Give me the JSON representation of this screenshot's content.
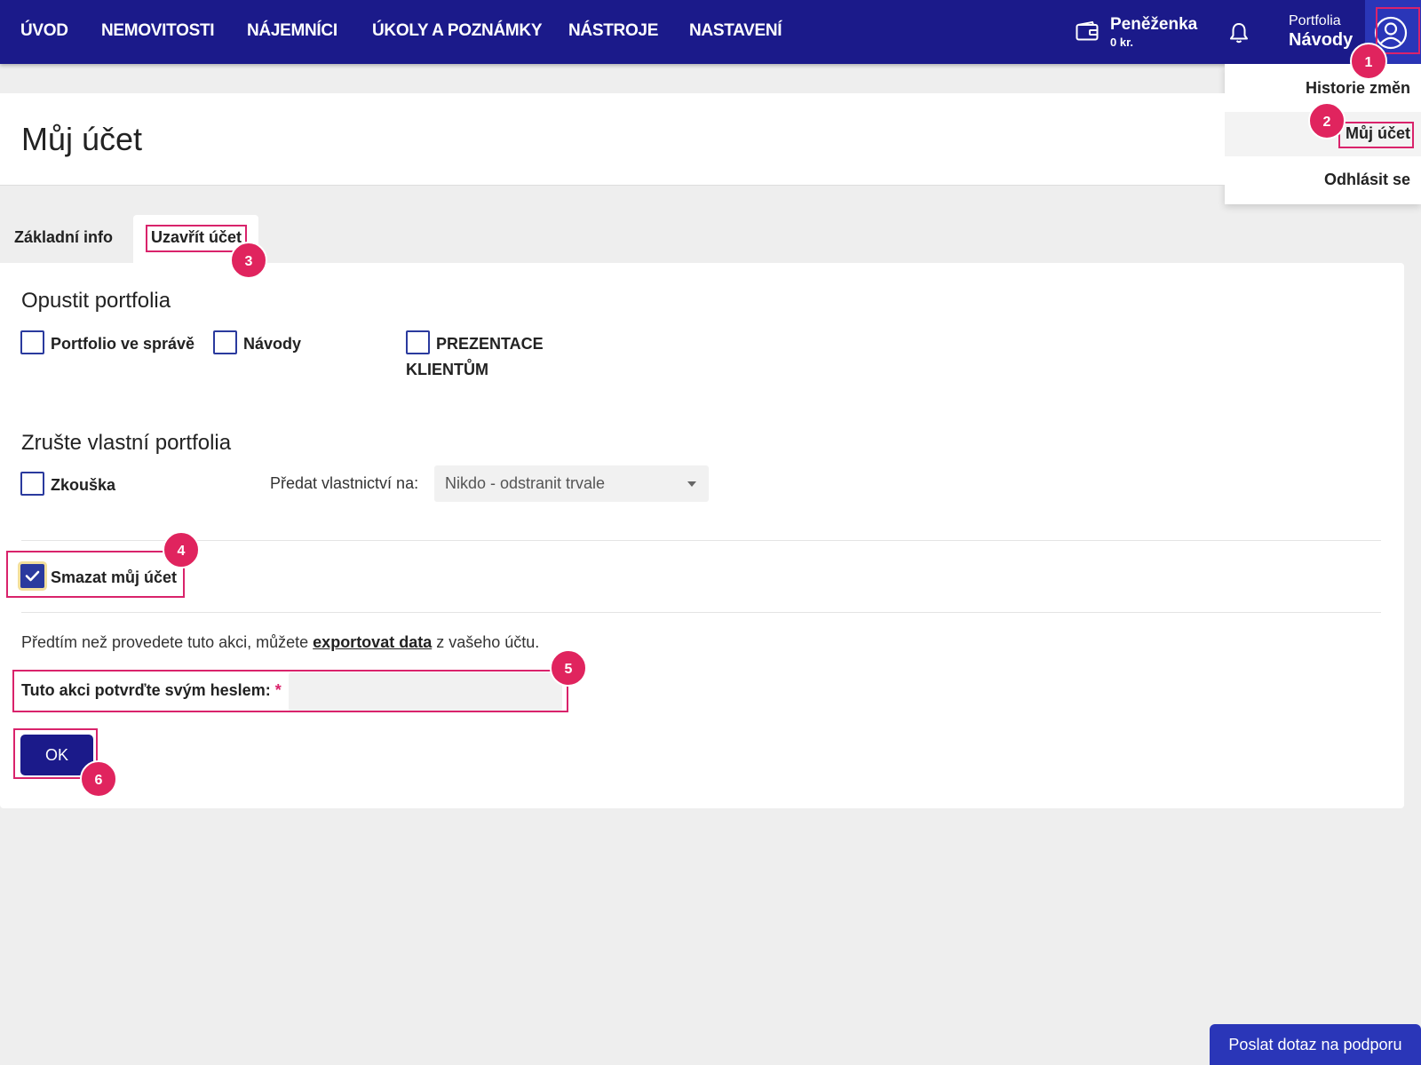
{
  "topnav": {
    "items": [
      "ÚVOD",
      "NEMOVITOSTI",
      "NÁJEMNÍCI",
      "ÚKOLY A POZNÁMKY",
      "NÁSTROJE",
      "NASTAVENÍ"
    ],
    "wallet": {
      "label": "Peněženka",
      "amount": "0 kr."
    },
    "portfolio": {
      "label": "Portfolia",
      "name": "Návody"
    }
  },
  "user_menu": {
    "items": [
      "Historie změn",
      "Můj účet",
      "Odhlásit se"
    ]
  },
  "page": {
    "title": "Můj účet"
  },
  "tabs": [
    "Základní info",
    "Uzavřít účet"
  ],
  "leave_portfolios": {
    "title": "Opustit portfolia",
    "options": [
      {
        "label": "Portfolio ve správě",
        "checked": false
      },
      {
        "label": "Návody",
        "checked": false
      },
      {
        "label_line1": "PREZENTACE",
        "label_line2": "KLIENTŮM",
        "checked": false
      }
    ]
  },
  "cancel_portfolios": {
    "title": "Zrušte vlastní portfolia",
    "option": {
      "label": "Zkouška",
      "checked": false
    },
    "transfer_label": "Předat vlastnictví na:",
    "transfer_value": "Nikdo - odstranit trvale"
  },
  "delete_account": {
    "label": "Smazat můj účet",
    "checked": true
  },
  "export": {
    "before": "Předtím než provedete tuto akci, můžete ",
    "link": "exportovat data",
    "after": " z vašeho účtu."
  },
  "password": {
    "label": "Tuto akci potvrďte svým heslem:",
    "required_mark": "*",
    "value": ""
  },
  "ok_button": "OK",
  "support_button": "Poslat dotaz na podporu",
  "badges": [
    "1",
    "2",
    "3",
    "4",
    "5",
    "6"
  ],
  "colors": {
    "topbar": "#1b1a8a",
    "accent": "#2a36b8",
    "highlight": "#d9236b",
    "badge": "#e0245e"
  }
}
